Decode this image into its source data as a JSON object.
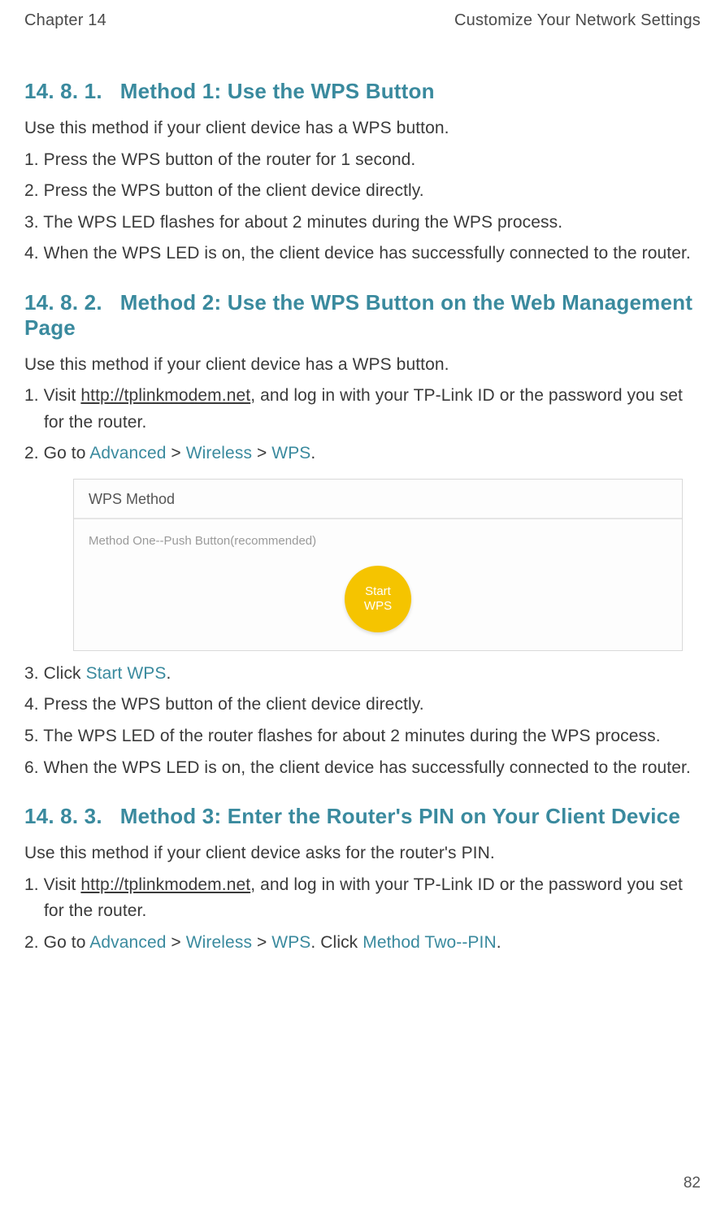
{
  "header": {
    "chapter": "Chapter 14",
    "title": "Customize Your Network Settings"
  },
  "page_number": "82",
  "section1": {
    "number": "14. 8. 1.",
    "title": "Method 1: Use the WPS Button",
    "intro": "Use this method if your client device has a WPS button.",
    "steps": [
      "1. Press the WPS button of the router for 1 second.",
      "2. Press the WPS button of the client device directly.",
      "3. The WPS LED flashes for about 2 minutes during the WPS process.",
      "4. When the WPS LED is on, the client device has successfully connected to the router."
    ]
  },
  "section2": {
    "number": "14. 8. 2.",
    "title": "Method 2: Use the WPS Button on the Web Management Page",
    "intro": "Use this method if your client device has a WPS button.",
    "step1_pre": "1. Visit ",
    "step1_link": "http://tplinkmodem.net",
    "step1_post": ", and log in with your TP-Link ID or the password you set for the router.",
    "step2_pre": "2. Go to ",
    "step2_nav1": "Advanced",
    "step2_gt1": " > ",
    "step2_nav2": "Wireless",
    "step2_gt2": " > ",
    "step2_nav3": "WPS",
    "step2_post": ".",
    "screenshot": {
      "panel_title": "WPS Method",
      "subtitle": "Method One--Push Button(recommended)",
      "button_line1": "Start",
      "button_line2": "WPS"
    },
    "step3_pre": "3. Click ",
    "step3_link": "Start WPS",
    "step3_post": ".",
    "steps_rest": [
      "4. Press the WPS button of the client device directly.",
      "5. The WPS LED of the router flashes for about 2 minutes during the WPS process.",
      "6. When the WPS LED is on, the client device has successfully connected to the router."
    ]
  },
  "section3": {
    "number": "14. 8. 3.",
    "title": "Method 3: Enter the Router's PIN on Your Client Device",
    "intro": "Use this method if your client device asks for the router's PIN.",
    "step1_pre": "1. Visit ",
    "step1_link": "http://tplinkmodem.net",
    "step1_post": ", and log in with your TP-Link ID or the password you set for the router.",
    "step2_pre": "2. Go to ",
    "step2_nav1": "Advanced",
    "step2_gt1": " > ",
    "step2_nav2": "Wireless",
    "step2_gt2": " > ",
    "step2_nav3": "WPS",
    "step2_mid": ". Click ",
    "step2_nav4": "Method Two--PIN",
    "step2_post": "."
  }
}
